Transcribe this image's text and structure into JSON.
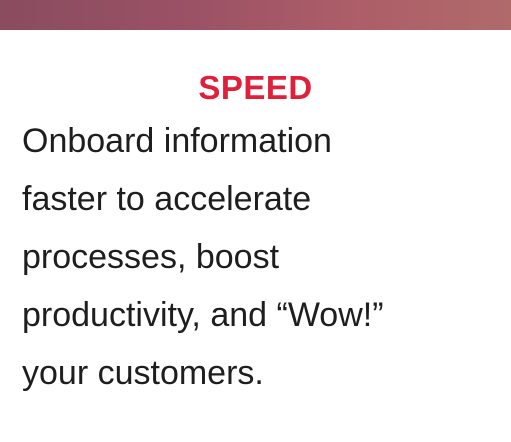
{
  "feature": {
    "heading": "SPEED",
    "description_lines": [
      "Onboard information",
      "faster to accelerate",
      "processes, boost",
      "productivity, and “Wow!”",
      "your customers."
    ]
  },
  "colors": {
    "heading": "#e0203a",
    "body_text": "#1e1e1e",
    "banner_start": "#8a4c5f",
    "banner_end": "#b06a6a"
  }
}
